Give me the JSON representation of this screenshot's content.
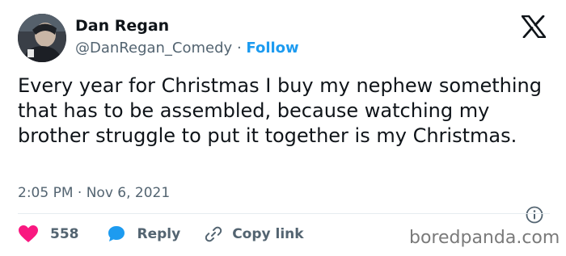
{
  "author": {
    "name": "Dan Regan",
    "handle": "@DanRegan_Comedy",
    "separator": "·",
    "follow_label": "Follow"
  },
  "tweet": {
    "text": "Every year for Christmas I buy my nephew something that has to be assembled, because watching my brother struggle to put it together is my Christmas.",
    "timestamp": "2:05 PM · Nov 6, 2021"
  },
  "actions": {
    "like_count": "558",
    "reply_label": "Reply",
    "copy_link_label": "Copy link"
  },
  "watermark": "boredpanda.com",
  "icons": {
    "platform": "x-logo-icon",
    "info": "info-icon",
    "like": "heart-icon",
    "reply": "speech-bubble-icon",
    "copy": "link-icon"
  },
  "colors": {
    "like": "#f91880",
    "reply": "#1d9bf0",
    "follow": "#1d9bf0",
    "text": "#0f1419",
    "muted": "#536471"
  }
}
